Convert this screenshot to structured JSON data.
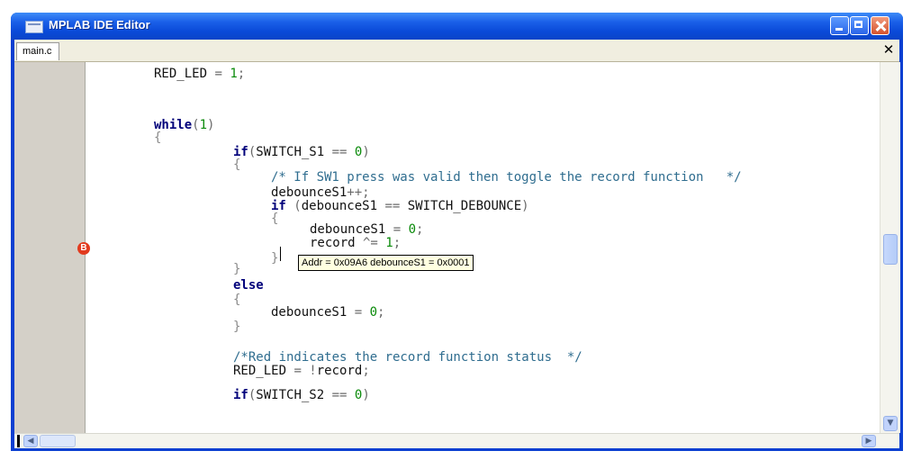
{
  "window": {
    "title": "MPLAB IDE Editor",
    "buttons": {
      "minimize": "minimize",
      "maximize": "maximize",
      "close": "close"
    }
  },
  "tabs": [
    {
      "label": "main.c"
    }
  ],
  "editor": {
    "breakpoint_label": "B",
    "lines": [
      {
        "parts": [
          [
            "id",
            "RED_LED"
          ],
          [
            "op",
            " = "
          ],
          [
            "num",
            "1"
          ],
          [
            "op",
            ";"
          ]
        ]
      },
      {
        "parts": [
          [
            "kw",
            "while"
          ],
          [
            "op",
            "("
          ],
          [
            "num",
            "1"
          ],
          [
            "op",
            ")"
          ]
        ]
      },
      {
        "parts": [
          [
            "br",
            "{"
          ]
        ]
      },
      {
        "parts": [
          [
            "kw",
            "if"
          ],
          [
            "op",
            "("
          ],
          [
            "id",
            "SWITCH_S1"
          ],
          [
            "op",
            " == "
          ],
          [
            "num",
            "0"
          ],
          [
            "op",
            ")"
          ]
        ]
      },
      {
        "parts": [
          [
            "br",
            "{"
          ]
        ]
      },
      {
        "parts": [
          [
            "cm",
            "/* If SW1 press was valid then toggle the record function   */"
          ]
        ]
      },
      {
        "parts": [
          [
            "id",
            "debounceS1"
          ],
          [
            "op",
            "++;"
          ]
        ]
      },
      {
        "parts": [
          [
            "kw",
            "if"
          ],
          [
            "op",
            " ("
          ],
          [
            "id",
            "debounceS1"
          ],
          [
            "op",
            " == "
          ],
          [
            "id",
            "SWITCH_DEBOUNCE"
          ],
          [
            "op",
            ")"
          ]
        ]
      },
      {
        "parts": [
          [
            "br",
            "{"
          ]
        ]
      },
      {
        "parts": [
          [
            "id",
            "debounceS1"
          ],
          [
            "op",
            " = "
          ],
          [
            "num",
            "0"
          ],
          [
            "op",
            ";"
          ]
        ]
      },
      {
        "parts": [
          [
            "id",
            "record"
          ],
          [
            "op",
            " ^= "
          ],
          [
            "num",
            "1"
          ],
          [
            "op",
            ";"
          ]
        ]
      },
      {
        "parts": [
          [
            "br",
            "}"
          ]
        ]
      },
      {
        "parts": [
          [
            "br",
            "}"
          ]
        ]
      },
      {
        "parts": [
          [
            "kw",
            "else"
          ]
        ]
      },
      {
        "parts": [
          [
            "br",
            "{"
          ]
        ]
      },
      {
        "parts": [
          [
            "id",
            "debounceS1"
          ],
          [
            "op",
            " = "
          ],
          [
            "num",
            "0"
          ],
          [
            "op",
            ";"
          ]
        ]
      },
      {
        "parts": [
          [
            "br",
            "}"
          ]
        ]
      },
      {
        "parts": [
          [
            "cm",
            "/*Red indicates the record function status  */"
          ]
        ]
      },
      {
        "parts": [
          [
            "id",
            "RED_LED"
          ],
          [
            "op",
            " = !"
          ],
          [
            "id",
            "record"
          ],
          [
            "op",
            ";"
          ]
        ]
      },
      {
        "parts": [
          [
            "kw",
            "if"
          ],
          [
            "op",
            "("
          ],
          [
            "id",
            "SWITCH_S2"
          ],
          [
            "op",
            " == "
          ],
          [
            "num",
            "0"
          ],
          [
            "op",
            ")"
          ]
        ]
      }
    ],
    "tooltip": "Addr = 0x09A6 debounceS1 = 0x0001"
  },
  "colors": {
    "titlebar": "#0a4ad8",
    "keyword": "#00007a",
    "comment": "#2f6d8f",
    "number": "#0a8a0a",
    "breakpoint": "#e23b1f",
    "tooltip_bg": "#ffffe1"
  },
  "icons": [
    "app-icon",
    "minimize-icon",
    "maximize-icon",
    "close-icon",
    "breakpoint-icon",
    "scroll-up-icon",
    "scroll-down-icon",
    "scroll-left-icon",
    "scroll-right-icon"
  ]
}
